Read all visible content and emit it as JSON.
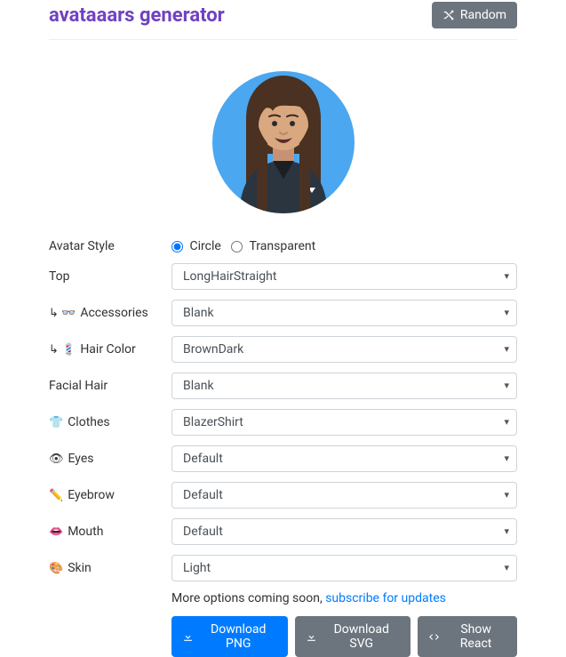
{
  "header": {
    "title": "avataaars generator",
    "random_label": "Random"
  },
  "style_row": {
    "label": "Avatar Style",
    "options": {
      "circle": "Circle",
      "transparent": "Transparent"
    },
    "selected": "circle"
  },
  "rows": [
    {
      "icon": "",
      "label": "Top",
      "value": "LongHairStraight"
    },
    {
      "icon": "↳ 👓",
      "label": "Accessories",
      "value": "Blank"
    },
    {
      "icon": "↳ 💈",
      "label": "Hair Color",
      "value": "BrownDark"
    },
    {
      "icon": "",
      "label": "Facial Hair",
      "value": "Blank"
    },
    {
      "icon": "👕",
      "label": "Clothes",
      "value": "BlazerShirt"
    },
    {
      "icon": "👁",
      "label": "Eyes",
      "value": "Default"
    },
    {
      "icon": "✏️",
      "label": "Eyebrow",
      "value": "Default"
    },
    {
      "icon": "👄",
      "label": "Mouth",
      "value": "Default"
    },
    {
      "icon": "🎨",
      "label": "Skin",
      "value": "Light"
    }
  ],
  "note": {
    "text": "More options coming soon, ",
    "link_text": "subscribe for updates"
  },
  "actions": {
    "png": "Download PNG",
    "svg": "Download SVG",
    "react": "Show React"
  }
}
